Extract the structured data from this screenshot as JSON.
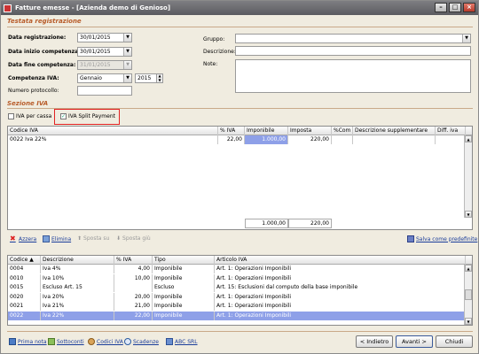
{
  "window": {
    "title": "Fatture emesse - [Azienda demo di Genioso]"
  },
  "testata": {
    "section_title": "Testata registrazione",
    "data_registrazione_label": "Data registrazione:",
    "data_registrazione": "30/01/2015",
    "data_inizio_label": "Data inizio competenza:",
    "data_inizio": "30/01/2015",
    "data_fine_label": "Data fine competenza:",
    "data_fine": "31/01/2015",
    "competenza_label": "Competenza IVA:",
    "competenza_mese": "Gennaio",
    "competenza_anno": "2015",
    "protocollo_label": "Numero protocollo:",
    "protocollo": "",
    "gruppo_label": "Gruppo:",
    "descrizione_label": "Descrizione:",
    "note_label": "Note:"
  },
  "sezione_iva": {
    "section_title": "Sezione IVA",
    "iva_per_cassa_label": "IVA per cassa",
    "split_payment_label": "IVA Split Payment",
    "columns": [
      "Codice IVA",
      "% IVA",
      "Imponibile",
      "Imposta",
      "%Com",
      "Descrizione supplementare",
      "Diff. iva"
    ],
    "rows": [
      {
        "codice": "0022  Iva 22%",
        "perc": "22,00",
        "imponibile": "1.000,00",
        "imposta": "220,00",
        "com": "",
        "descr": "",
        "diff": ""
      }
    ],
    "totale_imponibile": "1.000,00",
    "totale_imposta": "220,00"
  },
  "toolbar": {
    "azzera": "Azzera",
    "elimina": "Elimina",
    "sposta_su": "Sposta su",
    "sposta_giu": "Sposta giù",
    "salva_predefinite": "Salva come predefinite"
  },
  "codici": {
    "columns": [
      "Codice",
      "Descrizione",
      "% IVA",
      "Tipo",
      "Articolo IVA"
    ],
    "rows": [
      {
        "codice": "0004",
        "descr": "Iva 4%",
        "perc": "4,00",
        "tipo": "Imponibile",
        "articolo": "Art. 1: Operazioni Imponibili"
      },
      {
        "codice": "0010",
        "descr": "Iva 10%",
        "perc": "10,00",
        "tipo": "Imponibile",
        "articolo": "Art. 1: Operazioni Imponibili"
      },
      {
        "codice": "0015",
        "descr": "Escluso Art. 15",
        "perc": "",
        "tipo": "Escluso",
        "articolo": "Art. 15: Esclusioni dal computo della base imponibile"
      },
      {
        "codice": "0020",
        "descr": "Iva 20%",
        "perc": "20,00",
        "tipo": "Imponibile",
        "articolo": "Art. 1: Operazioni Imponibili"
      },
      {
        "codice": "0021",
        "descr": "Iva 21%",
        "perc": "21,00",
        "tipo": "Imponibile",
        "articolo": "Art. 1: Operazioni Imponibili"
      },
      {
        "codice": "0022",
        "descr": "Iva 22%",
        "perc": "22,00",
        "tipo": "Imponibile",
        "articolo": "Art. 1: Operazioni Imponibili"
      }
    ]
  },
  "footer": {
    "prima_nota": "Prima nota",
    "sottoconti": "Sottoconti",
    "codici_iva": "Codici IVA",
    "scadenze": "Scadenze",
    "abc_srl": "ABC SRL",
    "indietro": "< Indietro",
    "avanti": "Avanti >",
    "chiudi": "Chiudi"
  }
}
